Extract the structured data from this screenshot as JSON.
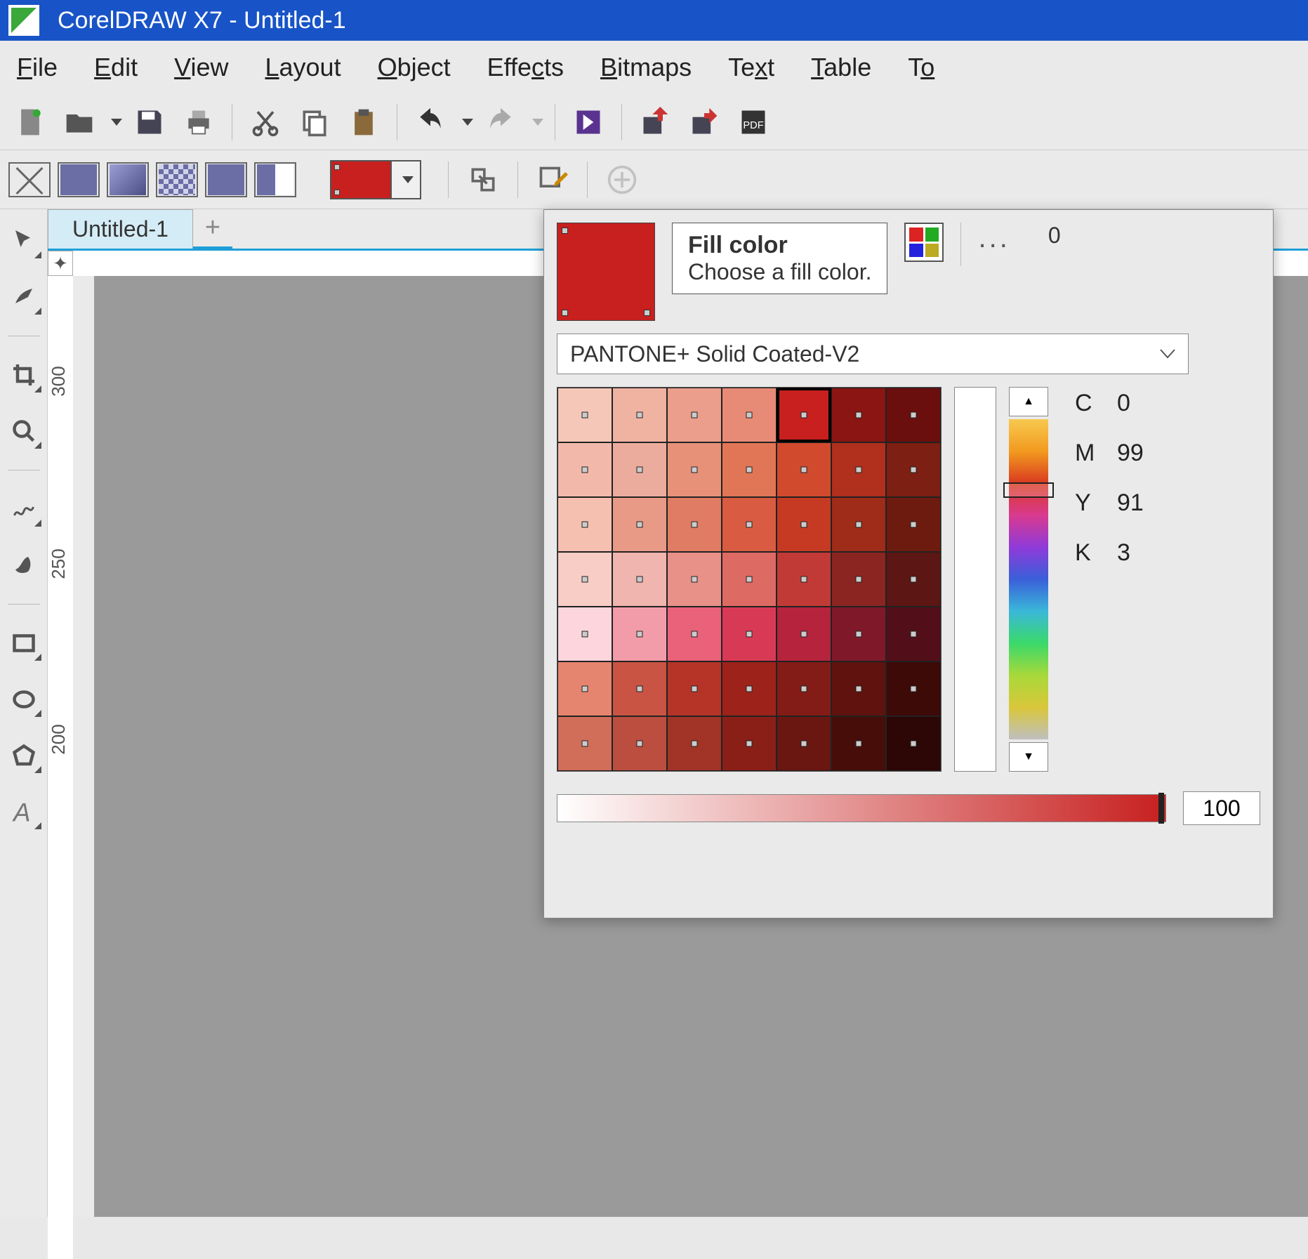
{
  "title": "CorelDRAW X7 - Untitled-1",
  "menu": [
    "File",
    "Edit",
    "View",
    "Layout",
    "Object",
    "Effects",
    "Bitmaps",
    "Text",
    "Table",
    "To"
  ],
  "tab_name": "Untitled-1",
  "ruler_h": {
    "a": "300",
    "b": "250"
  },
  "ruler_v": {
    "a": "300",
    "b": "250",
    "c": "200"
  },
  "ruler_right_num": "0",
  "popup": {
    "tooltip_title": "Fill color",
    "tooltip_desc": "Choose a fill color.",
    "palette_name": "PANTONE+ Solid Coated-V2",
    "cmyk": {
      "c": "0",
      "m": "99",
      "y": "91",
      "k": "3"
    },
    "tint": "100",
    "current_color": "#c7201f",
    "swatches": [
      [
        "#f4c7b8",
        "#f0b2a1",
        "#eb9e8b",
        "#e78a76",
        "#c7201f",
        "#8a1512",
        "#6a0f0d"
      ],
      [
        "#f2b9ab",
        "#ecac9d",
        "#e79179",
        "#e17656",
        "#d14a2e",
        "#b02f1d",
        "#7d1f12"
      ],
      [
        "#f6c0b0",
        "#e89a87",
        "#e07c63",
        "#d95c42",
        "#c63a24",
        "#9f2b19",
        "#6e1b0f"
      ],
      [
        "#f8cdc6",
        "#f0b5ae",
        "#e79189",
        "#dd6a63",
        "#c23a36",
        "#8b2521",
        "#5c1613"
      ],
      [
        "#fcd6dc",
        "#f39ca9",
        "#ea617a",
        "#d83a55",
        "#b5243c",
        "#7f1829",
        "#520e19"
      ],
      [
        "#e6856f",
        "#c95443",
        "#b53427",
        "#9d231a",
        "#831c16",
        "#5f120e",
        "#3d0a07"
      ],
      [
        "#d06e5a",
        "#bb4e3f",
        "#a23327",
        "#891f17",
        "#6a1611",
        "#470d09",
        "#2c0705"
      ]
    ],
    "selected_row": 0,
    "selected_col": 4
  }
}
